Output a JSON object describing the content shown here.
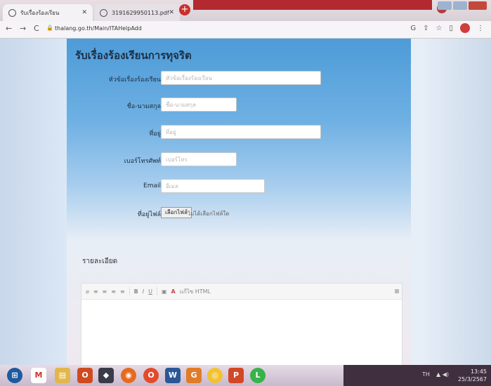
{
  "browser": {
    "tabs": [
      {
        "title": "รับเรื่องร้องเรียน",
        "active": true
      },
      {
        "title": "3191629950113.pdf",
        "active": false
      }
    ],
    "new_tab": "+",
    "url": "thalang.go.th/Main/ITAHelpAdd",
    "nav": {
      "back": "←",
      "forward": "→",
      "reload": "C"
    },
    "profile_dropdown": "v"
  },
  "form": {
    "title": "รับเรื่องร้องเรียนการทุจริต",
    "fields": {
      "subject": {
        "label": "หัวข้อเรื่องร้องเรียน",
        "placeholder": "หัวข้อเรื่องร้องเรียน"
      },
      "name": {
        "label": "ชื่อ-นามสกุล",
        "placeholder": "ชื่อ-นามสกุล"
      },
      "address": {
        "label": "ที่อยู่",
        "placeholder": "ที่อยู่"
      },
      "phone": {
        "label": "เบอร์โทรศัพท์",
        "placeholder": "เบอร์โทร"
      },
      "email": {
        "label": "Email",
        "placeholder": "อีเมล"
      },
      "attachment": {
        "label": "ที่อยู่ไฟล์",
        "button": "เลือกไฟล์",
        "status": "ไม่ได้เลือกไฟล์ใด"
      }
    },
    "detail_label": "รายละเอียด",
    "editor_toolbar": {
      "bold": "B",
      "italic": "I",
      "underline": "U",
      "font_color": "A",
      "source": "แก้ไข HTML"
    }
  },
  "taskbar": {
    "apps": [
      "start",
      "gmail",
      "explorer",
      "office",
      "wolf",
      "firefox",
      "opera",
      "word",
      "gimp",
      "chrome",
      "powerpoint",
      "line"
    ],
    "lang": "TH",
    "time": "13:45",
    "date": "25/3/2567"
  },
  "colors": {
    "panel_top": "#4d9bd8",
    "close_red": "#c34a3b",
    "tray": "#402f3e"
  }
}
